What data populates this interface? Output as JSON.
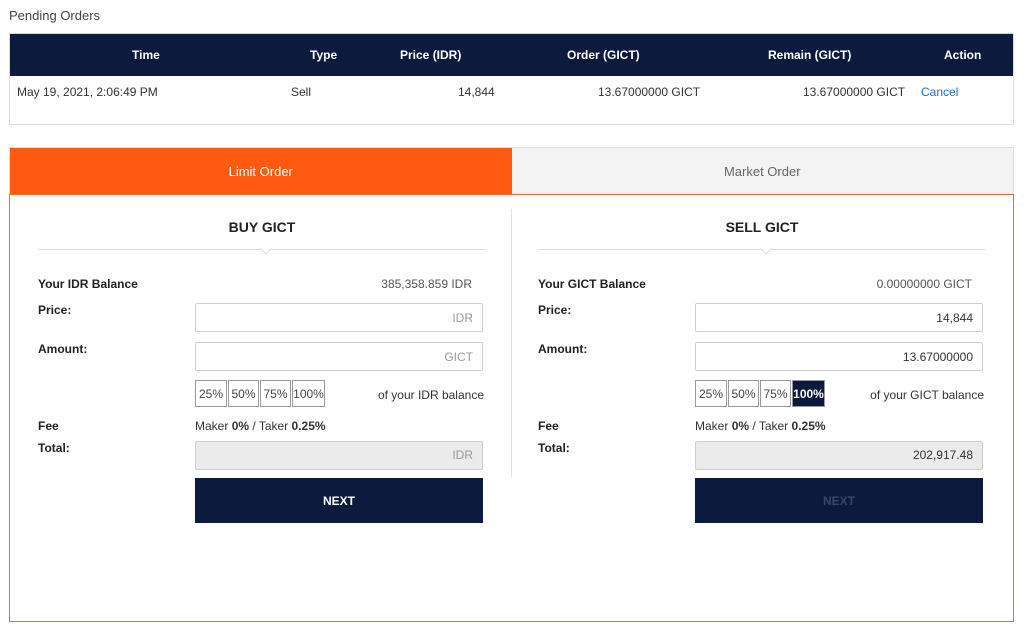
{
  "pending": {
    "title": "Pending Orders",
    "columns": [
      "Time",
      "Type",
      "Price (IDR)",
      "Order (GICT)",
      "Remain (GICT)",
      "Action"
    ],
    "rows": [
      {
        "time": "May 19, 2021, 2:06:49 PM",
        "type": "Sell",
        "price": "14,844",
        "order": "13.67000000 GICT",
        "remain": "13.67000000 GICT",
        "action": "Cancel"
      }
    ]
  },
  "tabs": {
    "limit": "Limit Order",
    "market": "Market Order",
    "active": "Limit Order"
  },
  "buy": {
    "title": "BUY GICT",
    "balance_label": "Your IDR Balance",
    "balance_value": "385,358.859 IDR",
    "price_label": "Price:",
    "price_value": "",
    "price_placeholder": "IDR",
    "amount_label": "Amount:",
    "amount_value": "",
    "amount_placeholder": "GICT",
    "percents": [
      "25%",
      "50%",
      "75%",
      "100%"
    ],
    "selected_percent": "",
    "percent_note": "of your IDR balance",
    "fee_label": "Fee",
    "maker_label": "Maker",
    "maker_value": "0%",
    "taker_label": "Taker",
    "taker_value": "0.25%",
    "total_label": "Total:",
    "total_value": "IDR",
    "next_label": "NEXT"
  },
  "sell": {
    "title": "SELL GICT",
    "balance_label": "Your GICT Balance",
    "balance_value": "0.00000000 GICT",
    "price_label": "Price:",
    "price_value": "14,844",
    "amount_label": "Amount:",
    "amount_value": "13.67000000",
    "percents": [
      "25%",
      "50%",
      "75%",
      "100%"
    ],
    "selected_percent": "100%",
    "percent_note": "of your GICT balance",
    "fee_label": "Fee",
    "maker_label": "Maker",
    "maker_value": "0%",
    "taker_label": "Taker",
    "taker_value": "0.25%",
    "total_label": "Total:",
    "total_value": "202,917.48",
    "next_label": "NEXT"
  },
  "colors": {
    "navy": "#0b1a3d",
    "accent": "#ff5a12",
    "link": "#1a6fbf"
  }
}
